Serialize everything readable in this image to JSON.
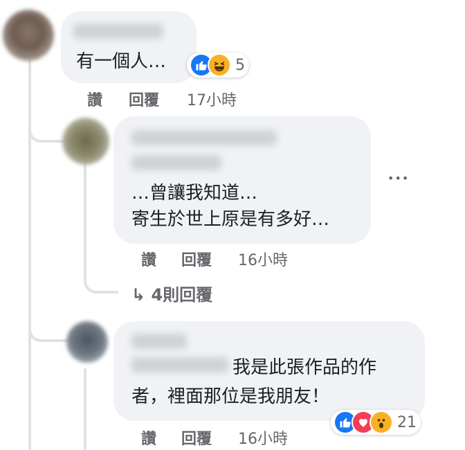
{
  "comments": [
    {
      "text_lines": [
        "有一個人…"
      ],
      "reactions": {
        "icons": [
          "like-icon",
          "haha-icon"
        ],
        "count": "5"
      },
      "actions": {
        "like": "讚",
        "reply": "回覆",
        "time": "17小時"
      }
    },
    {
      "text_lines": [
        "…曾讓我知道…",
        "寄生於世上原是有多好…"
      ],
      "more": "•••",
      "actions": {
        "like": "讚",
        "reply": "回覆",
        "time": "16小時"
      },
      "replies_link": "↳ 4則回覆"
    },
    {
      "text_lines": [
        "我是此張作品的作",
        "者，裡面那位是我朋友！"
      ],
      "reactions": {
        "icons": [
          "like-icon",
          "love-icon",
          "wow-icon"
        ],
        "count": "21"
      },
      "actions": {
        "like": "讚",
        "reply": "回覆",
        "time": "16小時"
      }
    }
  ],
  "colors": {
    "bubble": "#f0f2f5",
    "muted_text": "#65676b",
    "like_blue": "#1877f2",
    "love_red": "#f33e58",
    "emoji_yellow": "#f7b125"
  }
}
